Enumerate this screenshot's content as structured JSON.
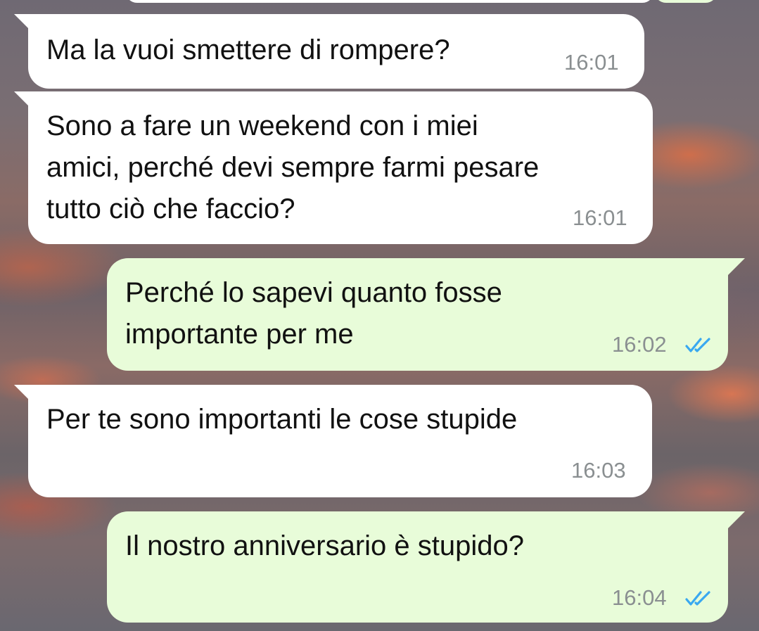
{
  "colors": {
    "incoming_bubble": "#ffffff",
    "outgoing_bubble": "#e8fcd9",
    "timestamp": "#8a8f91",
    "read_ticks": "#39a8f0"
  },
  "messages": [
    {
      "direction": "incoming",
      "text": "Ma la vuoi smettere di rompere?",
      "time": "16:01"
    },
    {
      "direction": "incoming",
      "text": "Sono a fare un weekend con i miei\namici, perché devi sempre farmi pesare\ntutto ciò che faccio?",
      "time": "16:01"
    },
    {
      "direction": "outgoing",
      "text": "Perché lo sapevi quanto fosse\nimportante per me",
      "time": "16:02",
      "status_icon": "double-check-read-icon"
    },
    {
      "direction": "incoming",
      "text": "Per te sono importanti le cose stupide",
      "time": "16:03"
    },
    {
      "direction": "outgoing",
      "text": "Il nostro anniversario è stupido?",
      "time": "16:04",
      "status_icon": "double-check-read-icon"
    }
  ]
}
